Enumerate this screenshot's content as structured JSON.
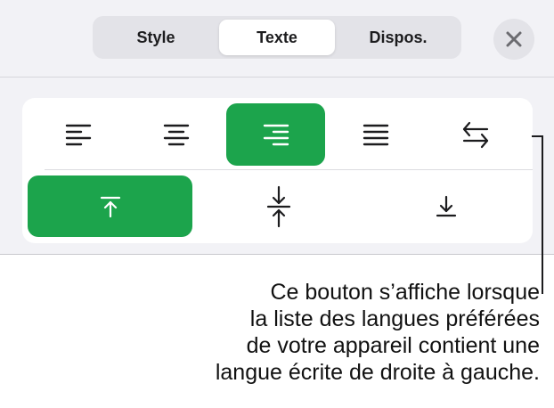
{
  "tabs": [
    {
      "label": "Style",
      "active": false
    },
    {
      "label": "Texte",
      "active": true
    },
    {
      "label": "Dispos.",
      "active": false
    }
  ],
  "close_icon": "close-icon",
  "horizontal_alignment": [
    {
      "icon": "align-left-icon",
      "selected": false
    },
    {
      "icon": "align-center-icon",
      "selected": false
    },
    {
      "icon": "align-right-icon",
      "selected": true
    },
    {
      "icon": "justify-icon",
      "selected": false
    },
    {
      "icon": "text-direction-icon",
      "selected": false
    }
  ],
  "vertical_alignment": [
    {
      "icon": "align-top-icon",
      "selected": true
    },
    {
      "icon": "align-middle-icon",
      "selected": false
    },
    {
      "icon": "align-bottom-icon",
      "selected": false
    }
  ],
  "callout": {
    "lines": [
      "Ce bouton s’affiche lorsque",
      "la liste des langues préférées",
      "de votre appareil contient une",
      "langue écrite de droite à gauche."
    ]
  },
  "colors": {
    "accent": "#1ca44c",
    "panel_background": "#f2f2f6",
    "segmented_background": "#e3e3e8"
  }
}
